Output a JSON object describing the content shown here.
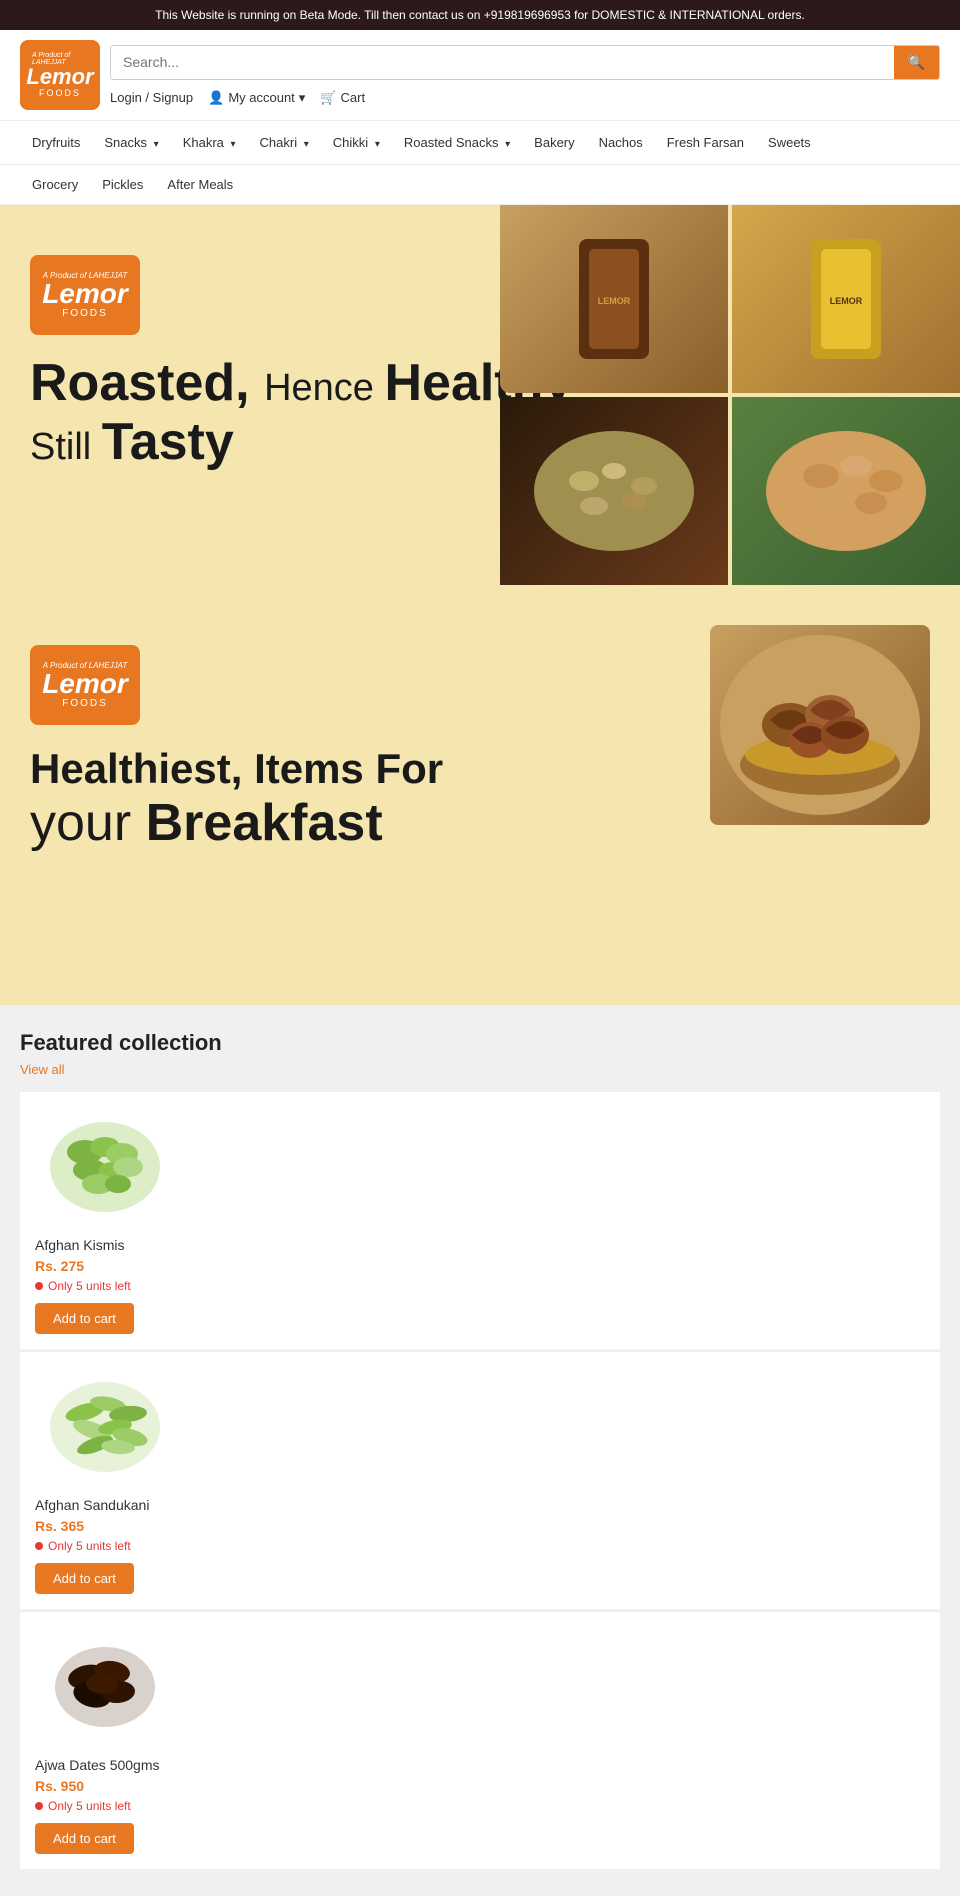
{
  "banner": {
    "text": "This Website is running on Beta Mode. Till then contact us on +919819696953 for DOMESTIC & INTERNATIONAL orders."
  },
  "header": {
    "logo": {
      "lahejjat": "A Product of LAHEJJAT",
      "lemor": "Lemor",
      "foods": "FOODS"
    },
    "search": {
      "placeholder": "Search..."
    },
    "account": {
      "login_label": "Login / Signup",
      "account_label": "My account",
      "cart_label": "Cart"
    }
  },
  "nav": {
    "row1": [
      {
        "label": "Dryfruits",
        "has_dropdown": false
      },
      {
        "label": "Snacks",
        "has_dropdown": true
      },
      {
        "label": "Khakra",
        "has_dropdown": true
      },
      {
        "label": "Chakri",
        "has_dropdown": true
      },
      {
        "label": "Chikki",
        "has_dropdown": true
      },
      {
        "label": "Roasted Snacks",
        "has_dropdown": true
      },
      {
        "label": "Bakery",
        "has_dropdown": false
      },
      {
        "label": "Nachos",
        "has_dropdown": false
      },
      {
        "label": "Fresh Farsan",
        "has_dropdown": false
      },
      {
        "label": "Sweets",
        "has_dropdown": false
      }
    ],
    "row2": [
      {
        "label": "Grocery",
        "has_dropdown": false
      },
      {
        "label": "Pickles",
        "has_dropdown": false
      },
      {
        "label": "After Meals",
        "has_dropdown": false
      }
    ]
  },
  "hero": {
    "logo1": {
      "lahejjat": "A Product of LAHEJJAT",
      "lemor": "Lemor",
      "foods": "FOODS"
    },
    "slide1_heading1": "Roasted,",
    "slide1_heading1_light": "Hence",
    "slide1_heading1_bold": "Healthy",
    "slide1_heading2_light": "Still",
    "slide1_heading2_bold": "Tasty",
    "logo2": {
      "lahejjat": "A Product of LAHEJJAT",
      "lemor": "Lemor",
      "foods": "FOODS"
    },
    "slide2_heading1": "Healthiest, Items For",
    "slide2_heading2_light": "your",
    "slide2_heading2_bold": "Breakfast"
  },
  "featured": {
    "title": "Featured collection",
    "view_all": "View all",
    "products": [
      {
        "name": "Afghan Kismis",
        "price": "Rs. 275",
        "stock_text": "Only 5 units left",
        "add_to_cart": "Add to cart",
        "img_type": "kismis"
      },
      {
        "name": "Afghan Sandukani",
        "price": "Rs. 365",
        "stock_text": "Only 5 units left",
        "add_to_cart": "Add to cart",
        "img_type": "sandukani"
      },
      {
        "name": "Ajwa Dates 500gms",
        "price": "Rs. 950",
        "stock_text": "Only 5 units left",
        "add_to_cart": "Add to cart",
        "img_type": "dates"
      }
    ]
  },
  "colors": {
    "orange": "#e87722",
    "dark_brown": "#2c1a1a",
    "text_dark": "#222222",
    "price_color": "#e87722",
    "stock_color": "#e53935"
  }
}
